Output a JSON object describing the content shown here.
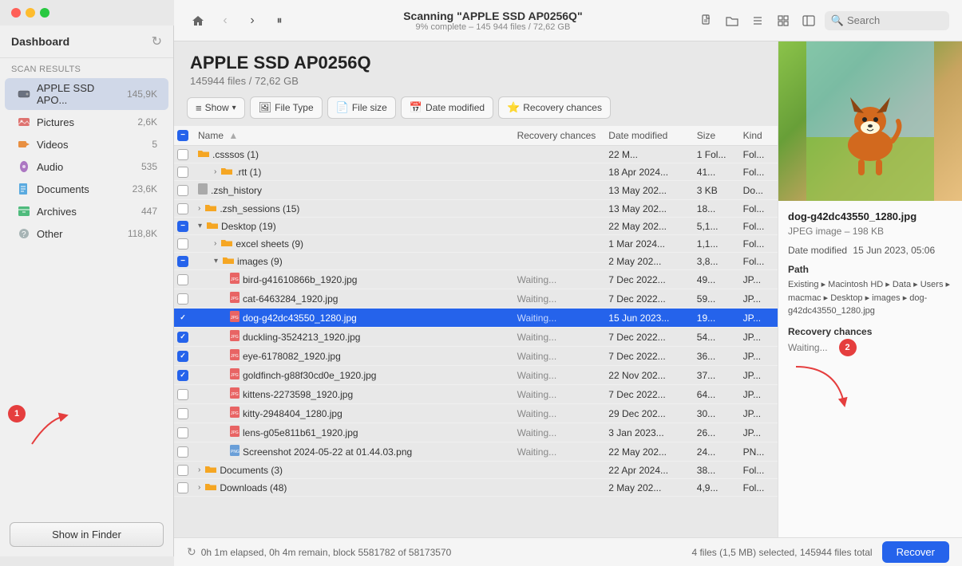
{
  "window": {
    "title": "Scanning \"APPLE SSD AP0256Q\"",
    "subtitle": "9% complete – 145 944 files / 72,62 GB"
  },
  "toolbar": {
    "home_label": "⌂",
    "back_label": "‹",
    "forward_label": "›",
    "pause_label": "⏸",
    "search_placeholder": "Search",
    "new_file_icon": "📄",
    "new_folder_icon": "📁",
    "list_icon": "≡",
    "grid_icon": "⊞",
    "sidebar_icon": "▭"
  },
  "sidebar": {
    "dashboard_label": "Dashboard",
    "scan_results_label": "Scan results",
    "items": [
      {
        "id": "apple-ssd",
        "label": "APPLE SSD APO...",
        "count": "145,9K",
        "active": true
      },
      {
        "id": "pictures",
        "label": "Pictures",
        "count": "2,6K"
      },
      {
        "id": "videos",
        "label": "Videos",
        "count": "5"
      },
      {
        "id": "audio",
        "label": "Audio",
        "count": "535"
      },
      {
        "id": "documents",
        "label": "Documents",
        "count": "23,6K"
      },
      {
        "id": "archives",
        "label": "Archives",
        "count": "447"
      },
      {
        "id": "other",
        "label": "Other",
        "count": "118,8K"
      }
    ],
    "show_in_finder": "Show in Finder"
  },
  "file_panel": {
    "title": "APPLE SSD AP0256Q",
    "subtitle": "145944 files / 72,62 GB",
    "filters": {
      "show": "Show",
      "file_type": "File Type",
      "file_size": "File size",
      "date_modified": "Date modified",
      "recovery_chances": "Recovery chances"
    },
    "table_headers": {
      "name": "Name",
      "recovery_chances": "Recovery chances",
      "date_modified": "Date modified",
      "size": "Size",
      "kind": "Kind"
    },
    "rows": [
      {
        "id": 1,
        "indent": 0,
        "checked": false,
        "indeterminate": false,
        "expand": false,
        "name": ".csssos (1)",
        "recovery": "",
        "date": "22 M...",
        "size": "1 Fol...",
        "kind": "Fol...",
        "is_folder": true,
        "icon": "folder"
      },
      {
        "id": 2,
        "indent": 1,
        "checked": false,
        "indeterminate": false,
        "expand": true,
        "name": ".rtt (1)",
        "recovery": "",
        "date": "18 Apr 2024...",
        "size": "41...",
        "kind": "Fol...",
        "is_folder": true,
        "icon": "folder"
      },
      {
        "id": 3,
        "indent": 0,
        "checked": false,
        "indeterminate": false,
        "expand": false,
        "name": ".zsh_history",
        "recovery": "",
        "date": "13 May 202...",
        "size": "3 KB",
        "kind": "Do...",
        "is_folder": false,
        "icon": "doc"
      },
      {
        "id": 4,
        "indent": 0,
        "checked": false,
        "indeterminate": false,
        "expand": true,
        "name": ".zsh_sessions (15)",
        "recovery": "",
        "date": "13 May 202...",
        "size": "18...",
        "kind": "Fol...",
        "is_folder": true,
        "icon": "folder"
      },
      {
        "id": 5,
        "indent": 0,
        "checked": false,
        "indeterminate": true,
        "expand": true,
        "collapsed": false,
        "name": "Desktop (19)",
        "recovery": "",
        "date": "22 May 202...",
        "size": "5,1...",
        "kind": "Fol...",
        "is_folder": true,
        "icon": "folder"
      },
      {
        "id": 6,
        "indent": 1,
        "checked": false,
        "indeterminate": false,
        "expand": true,
        "name": "excel sheets (9)",
        "recovery": "",
        "date": "1 Mar 2024...",
        "size": "1,1...",
        "kind": "Fol...",
        "is_folder": true,
        "icon": "folder"
      },
      {
        "id": 7,
        "indent": 1,
        "checked": false,
        "indeterminate": true,
        "expand": true,
        "collapsed": false,
        "name": "images (9)",
        "recovery": "",
        "date": "2 May 202...",
        "size": "3,8...",
        "kind": "Fol...",
        "is_folder": true,
        "icon": "folder"
      },
      {
        "id": 8,
        "indent": 2,
        "checked": false,
        "indeterminate": false,
        "expand": false,
        "name": "bird-g41610866b_1920.jpg",
        "recovery": "Waiting...",
        "date": "7 Dec 2022...",
        "size": "49...",
        "kind": "JP...",
        "is_folder": false,
        "icon": "jpg"
      },
      {
        "id": 9,
        "indent": 2,
        "checked": false,
        "indeterminate": false,
        "expand": false,
        "name": "cat-6463284_1920.jpg",
        "recovery": "Waiting...",
        "date": "7 Dec 2022...",
        "size": "59...",
        "kind": "JP...",
        "is_folder": false,
        "icon": "jpg"
      },
      {
        "id": 10,
        "indent": 2,
        "checked": true,
        "indeterminate": false,
        "expand": false,
        "selected": true,
        "name": "dog-g42dc43550_1280.jpg",
        "recovery": "Waiting...",
        "date": "15 Jun 2023...",
        "size": "19...",
        "kind": "JP...",
        "is_folder": false,
        "icon": "jpg"
      },
      {
        "id": 11,
        "indent": 2,
        "checked": true,
        "indeterminate": false,
        "expand": false,
        "name": "duckling-3524213_1920.jpg",
        "recovery": "Waiting...",
        "date": "7 Dec 2022...",
        "size": "54...",
        "kind": "JP...",
        "is_folder": false,
        "icon": "jpg"
      },
      {
        "id": 12,
        "indent": 2,
        "checked": true,
        "indeterminate": false,
        "expand": false,
        "name": "eye-6178082_1920.jpg",
        "recovery": "Waiting...",
        "date": "7 Dec 2022...",
        "size": "36...",
        "kind": "JP...",
        "is_folder": false,
        "icon": "jpg"
      },
      {
        "id": 13,
        "indent": 2,
        "checked": true,
        "indeterminate": false,
        "expand": false,
        "name": "goldfinch-g88f30cd0e_1920.jpg",
        "recovery": "Waiting...",
        "date": "22 Nov 202...",
        "size": "37...",
        "kind": "JP...",
        "is_folder": false,
        "icon": "jpg"
      },
      {
        "id": 14,
        "indent": 2,
        "checked": false,
        "indeterminate": false,
        "expand": false,
        "name": "kittens-2273598_1920.jpg",
        "recovery": "Waiting...",
        "date": "7 Dec 2022...",
        "size": "64...",
        "kind": "JP...",
        "is_folder": false,
        "icon": "jpg"
      },
      {
        "id": 15,
        "indent": 2,
        "checked": false,
        "indeterminate": false,
        "expand": false,
        "name": "kitty-2948404_1280.jpg",
        "recovery": "Waiting...",
        "date": "29 Dec 202...",
        "size": "30...",
        "kind": "JP...",
        "is_folder": false,
        "icon": "jpg"
      },
      {
        "id": 16,
        "indent": 2,
        "checked": false,
        "indeterminate": false,
        "expand": false,
        "name": "lens-g05e811b61_1920.jpg",
        "recovery": "Waiting...",
        "date": "3 Jan 2023...",
        "size": "26...",
        "kind": "JP...",
        "is_folder": false,
        "icon": "jpg"
      },
      {
        "id": 17,
        "indent": 2,
        "checked": false,
        "indeterminate": false,
        "expand": false,
        "name": "Screenshot 2024-05-22 at 01.44.03.png",
        "recovery": "Waiting...",
        "date": "22 May 202...",
        "size": "24...",
        "kind": "PN...",
        "is_folder": false,
        "icon": "png"
      },
      {
        "id": 18,
        "indent": 0,
        "checked": false,
        "indeterminate": false,
        "expand": true,
        "name": "Documents (3)",
        "recovery": "",
        "date": "22 Apr 2024...",
        "size": "38...",
        "kind": "Fol...",
        "is_folder": true,
        "icon": "folder"
      },
      {
        "id": 19,
        "indent": 0,
        "checked": false,
        "indeterminate": false,
        "expand": true,
        "name": "Downloads (48)",
        "recovery": "",
        "date": "2 May 202...",
        "size": "4,9...",
        "kind": "Fol...",
        "is_folder": true,
        "icon": "folder"
      }
    ]
  },
  "details": {
    "filename": "dog-g42dc43550_1280.jpg",
    "filetype": "JPEG image – 198 KB",
    "date_modified_label": "Date modified",
    "date_modified_value": "15 Jun 2023, 05:06",
    "path_label": "Path",
    "path_value": "Existing ▸ Macintosh HD ▸ Data ▸ Users ▸ macmac ▸ Desktop ▸ images ▸ dog-g42dc43550_1280.jpg",
    "recovery_chances_label": "Recovery chances",
    "recovery_chances_value": "Waiting..."
  },
  "status_bar": {
    "spinner": "↻",
    "left_text": "0h 1m elapsed, 0h 4m remain, block 5581782 of 58173570",
    "right_text": "4 files (1,5 MB) selected, 145944 files total",
    "recover_button": "Recover"
  },
  "annotations": {
    "badge_1": "1",
    "badge_2": "2"
  }
}
